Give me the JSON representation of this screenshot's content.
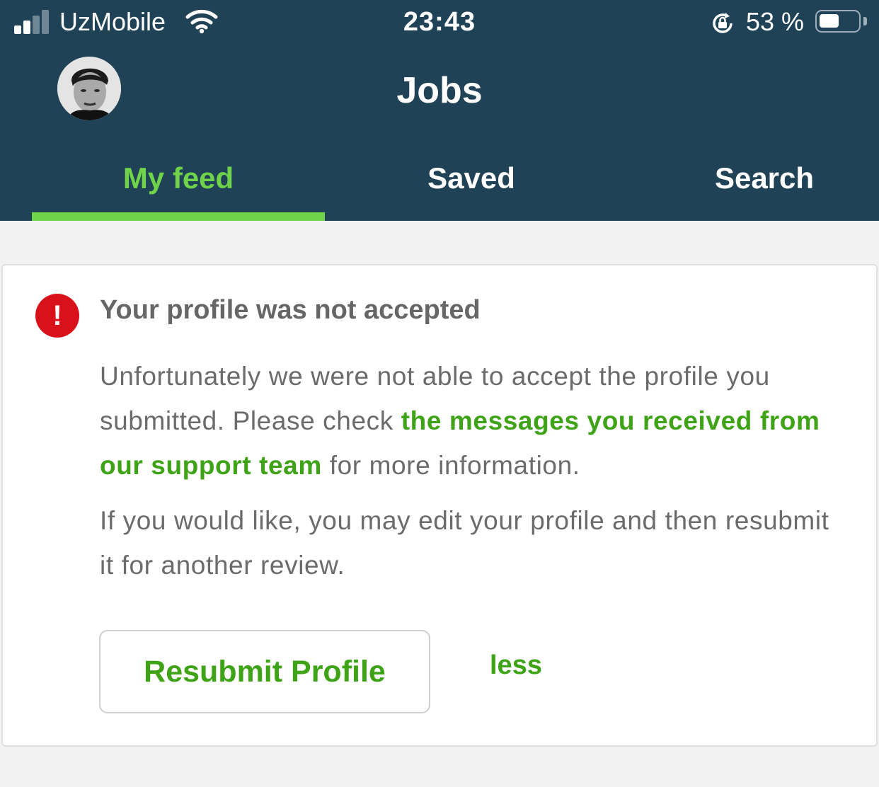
{
  "status_bar": {
    "carrier": "UzMobile",
    "time": "23:43",
    "battery_percent": "53 %",
    "battery_level": 0.53,
    "signal_bars": 2,
    "icons": [
      "signal-icon",
      "wifi-icon",
      "orientation-lock-icon",
      "battery-icon"
    ]
  },
  "header": {
    "title": "Jobs",
    "avatar": "profile-photo"
  },
  "tabs": {
    "items": [
      {
        "label": "My feed",
        "active": true
      },
      {
        "label": "Saved",
        "active": false
      },
      {
        "label": "Search",
        "active": false
      }
    ]
  },
  "alert": {
    "icon": "exclamation-icon",
    "title": "Your profile was not accepted",
    "para1_before": "Unfortunately we were not able to accept the profile you submitted. Please check ",
    "para1_link": "the messages you received from our support team",
    "para1_after": " for more information.",
    "para2": "If you would like, you may edit your profile and then resubmit it for another review.",
    "resubmit_label": "Resubmit Profile",
    "less_label": "less"
  },
  "colors": {
    "header_bg": "#1f4256",
    "accent_green": "#6fd44a",
    "link_green": "#3ea316",
    "alert_red": "#d8111b",
    "page_bg": "#f2f2f3"
  }
}
